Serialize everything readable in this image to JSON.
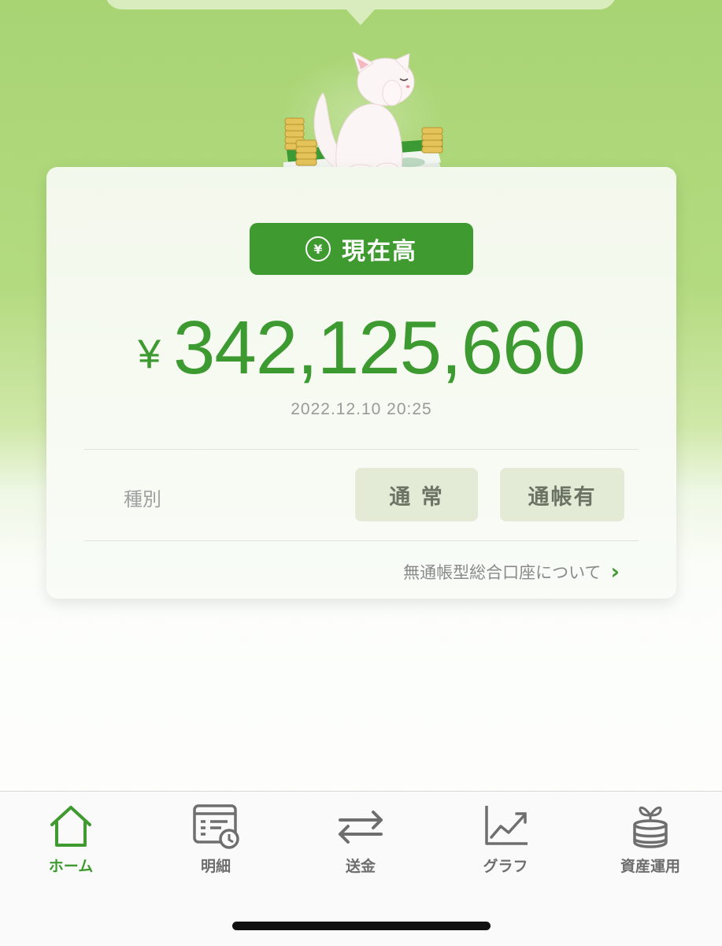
{
  "balance": {
    "badge_label": "現在高",
    "currency_symbol": "¥",
    "amount": "342,125,660",
    "timestamp": "2022.12.10 20:25"
  },
  "account_type": {
    "label": "種別",
    "tags": [
      "通 常",
      "通帳有"
    ]
  },
  "info_link": "無通帳型総合口座について",
  "tabs": [
    {
      "label": "ホーム",
      "icon": "home-icon",
      "active": true
    },
    {
      "label": "明細",
      "icon": "statement-icon",
      "active": false
    },
    {
      "label": "送金",
      "icon": "transfer-icon",
      "active": false
    },
    {
      "label": "グラフ",
      "icon": "graph-icon",
      "active": false
    },
    {
      "label": "資産運用",
      "icon": "investment-icon",
      "active": false
    }
  ],
  "colors": {
    "accent": "#3f9a2f",
    "tab_inactive": "#6e6e6e",
    "tag_bg": "#e3ead6"
  }
}
